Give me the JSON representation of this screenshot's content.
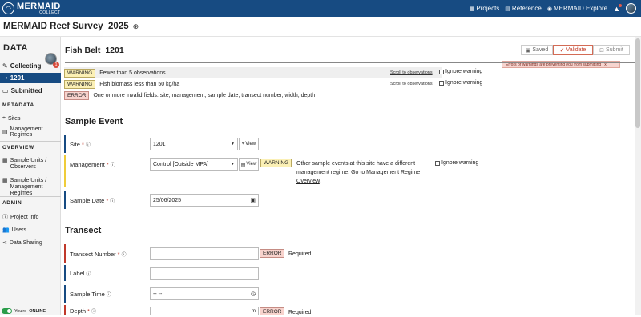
{
  "app": {
    "logo_name": "MERMAID",
    "logo_sub": "COLLECT",
    "nav": {
      "projects": "Projects",
      "reference": "Reference",
      "explore": "MERMAID Explore"
    }
  },
  "project": {
    "title": "MERMAID Reef Survey_2025"
  },
  "sidebar": {
    "data_heading": "DATA",
    "collecting": "Collecting",
    "collecting_badge": "1",
    "active_record": "1201",
    "submitted": "Submitted",
    "metadata_heading": "METADATA",
    "sites": "Sites",
    "management_regimes": "Management Regimes",
    "overview_heading": "OVERVIEW",
    "su_observers": "Sample Units / Observers",
    "su_mgmt": "Sample Units / Management Regimes",
    "admin_heading": "ADMIN",
    "project_info": "Project Info",
    "users": "Users",
    "data_sharing": "Data Sharing",
    "online_prefix": "You're",
    "online_status": "ONLINE"
  },
  "record": {
    "type": "Fish Belt",
    "number": "1201",
    "steps": {
      "saved": "Saved",
      "validate": "Validate",
      "submit": "Submit"
    },
    "error_tip": "Errors or warnings are preventing you from submitting",
    "error_tip_close": "x"
  },
  "validations": [
    {
      "level": "WARNING",
      "text": "Fewer than 5 observations",
      "link": "Scroll to observations",
      "ignore": "Ignore warning"
    },
    {
      "level": "WARNING",
      "text": "Fish biomass less than 50 kg/ha",
      "link": "Scroll to observations",
      "ignore": "Ignore warning"
    },
    {
      "level": "ERROR",
      "text": "One or more invalid fields: site, management, sample date, transect number, width, depth"
    }
  ],
  "sample_event": {
    "heading": "Sample Event",
    "site_label": "Site",
    "site_value": "1201",
    "view_label": "View",
    "management_label": "Management",
    "management_value": "Control [Outside MPA]",
    "management_warning_badge": "WARNING",
    "management_warning_text": "Other sample events at this site have a different management regime. Go to",
    "management_warning_link": "Management Regime Overview",
    "management_warning_end": ".",
    "management_ignore": "Ignore warning",
    "sample_date_label": "Sample Date",
    "sample_date_value": "25/06/2025"
  },
  "transect": {
    "heading": "Transect",
    "number_label": "Transect Number",
    "number_error_badge": "ERROR",
    "number_error_text": "Required",
    "label_label": "Label",
    "time_label": "Sample Time",
    "time_value": "--.--",
    "depth_label": "Depth",
    "depth_unit": "m",
    "depth_error_badge": "ERROR",
    "depth_error_text": "Required"
  },
  "colors": {
    "brand": "#174b82",
    "warning": "#fbf0b5",
    "error": "#f8d3cd",
    "online": "#2a9d4a"
  }
}
